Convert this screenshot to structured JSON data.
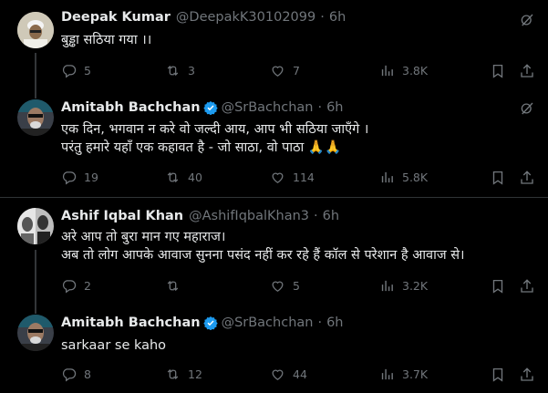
{
  "tweets": [
    {
      "name": "Deepak Kumar",
      "handle": "@DeepakK30102099",
      "time": "6h",
      "lines": [
        "बुड्ढा सठिया गया ।।"
      ],
      "replies": "5",
      "reposts": "3",
      "likes": "7",
      "views": "3.8K",
      "verified": false
    },
    {
      "name": "Amitabh Bachchan",
      "handle": "@SrBachchan",
      "time": "6h",
      "lines": [
        "एक दिन, भगवान न करे वो जल्दी आय, आप भी सठिया जाएँगे ।",
        "परंतु हमारे यहाँ एक कहावत है  - जो साठा, वो पाठा 🙏🙏"
      ],
      "replies": "19",
      "reposts": "40",
      "likes": "114",
      "views": "5.8K",
      "verified": true
    },
    {
      "name": "Ashif Iqbal Khan",
      "handle": "@AshifIqbalKhan3",
      "time": "6h",
      "lines": [
        "अरे आप तो बुरा मान गए महाराज।",
        "अब तो लोग आपके आवाज सुनना पसंद नहीं कर रहे हैं कॉल से परेशान है आवाज से।"
      ],
      "replies": "2",
      "reposts": "",
      "likes": "5",
      "views": "3.2K",
      "verified": false
    },
    {
      "name": "Amitabh Bachchan",
      "handle": "@SrBachchan",
      "time": "6h",
      "lines": [
        "sarkaar se kaho"
      ],
      "replies": "8",
      "reposts": "12",
      "likes": "44",
      "views": "3.7K",
      "verified": true
    }
  ],
  "separator": "·",
  "icons": {
    "reply": "reply-icon",
    "repost": "repost-icon",
    "like": "heart-icon",
    "views": "analytics-icon",
    "bookmark": "bookmark-icon",
    "share": "share-icon",
    "grok": "grok-icon",
    "verified": "verified-badge-icon"
  },
  "colors": {
    "background": "#000000",
    "text": "#e7e9ea",
    "muted": "#71767b",
    "verified": "#1d9bf0"
  }
}
